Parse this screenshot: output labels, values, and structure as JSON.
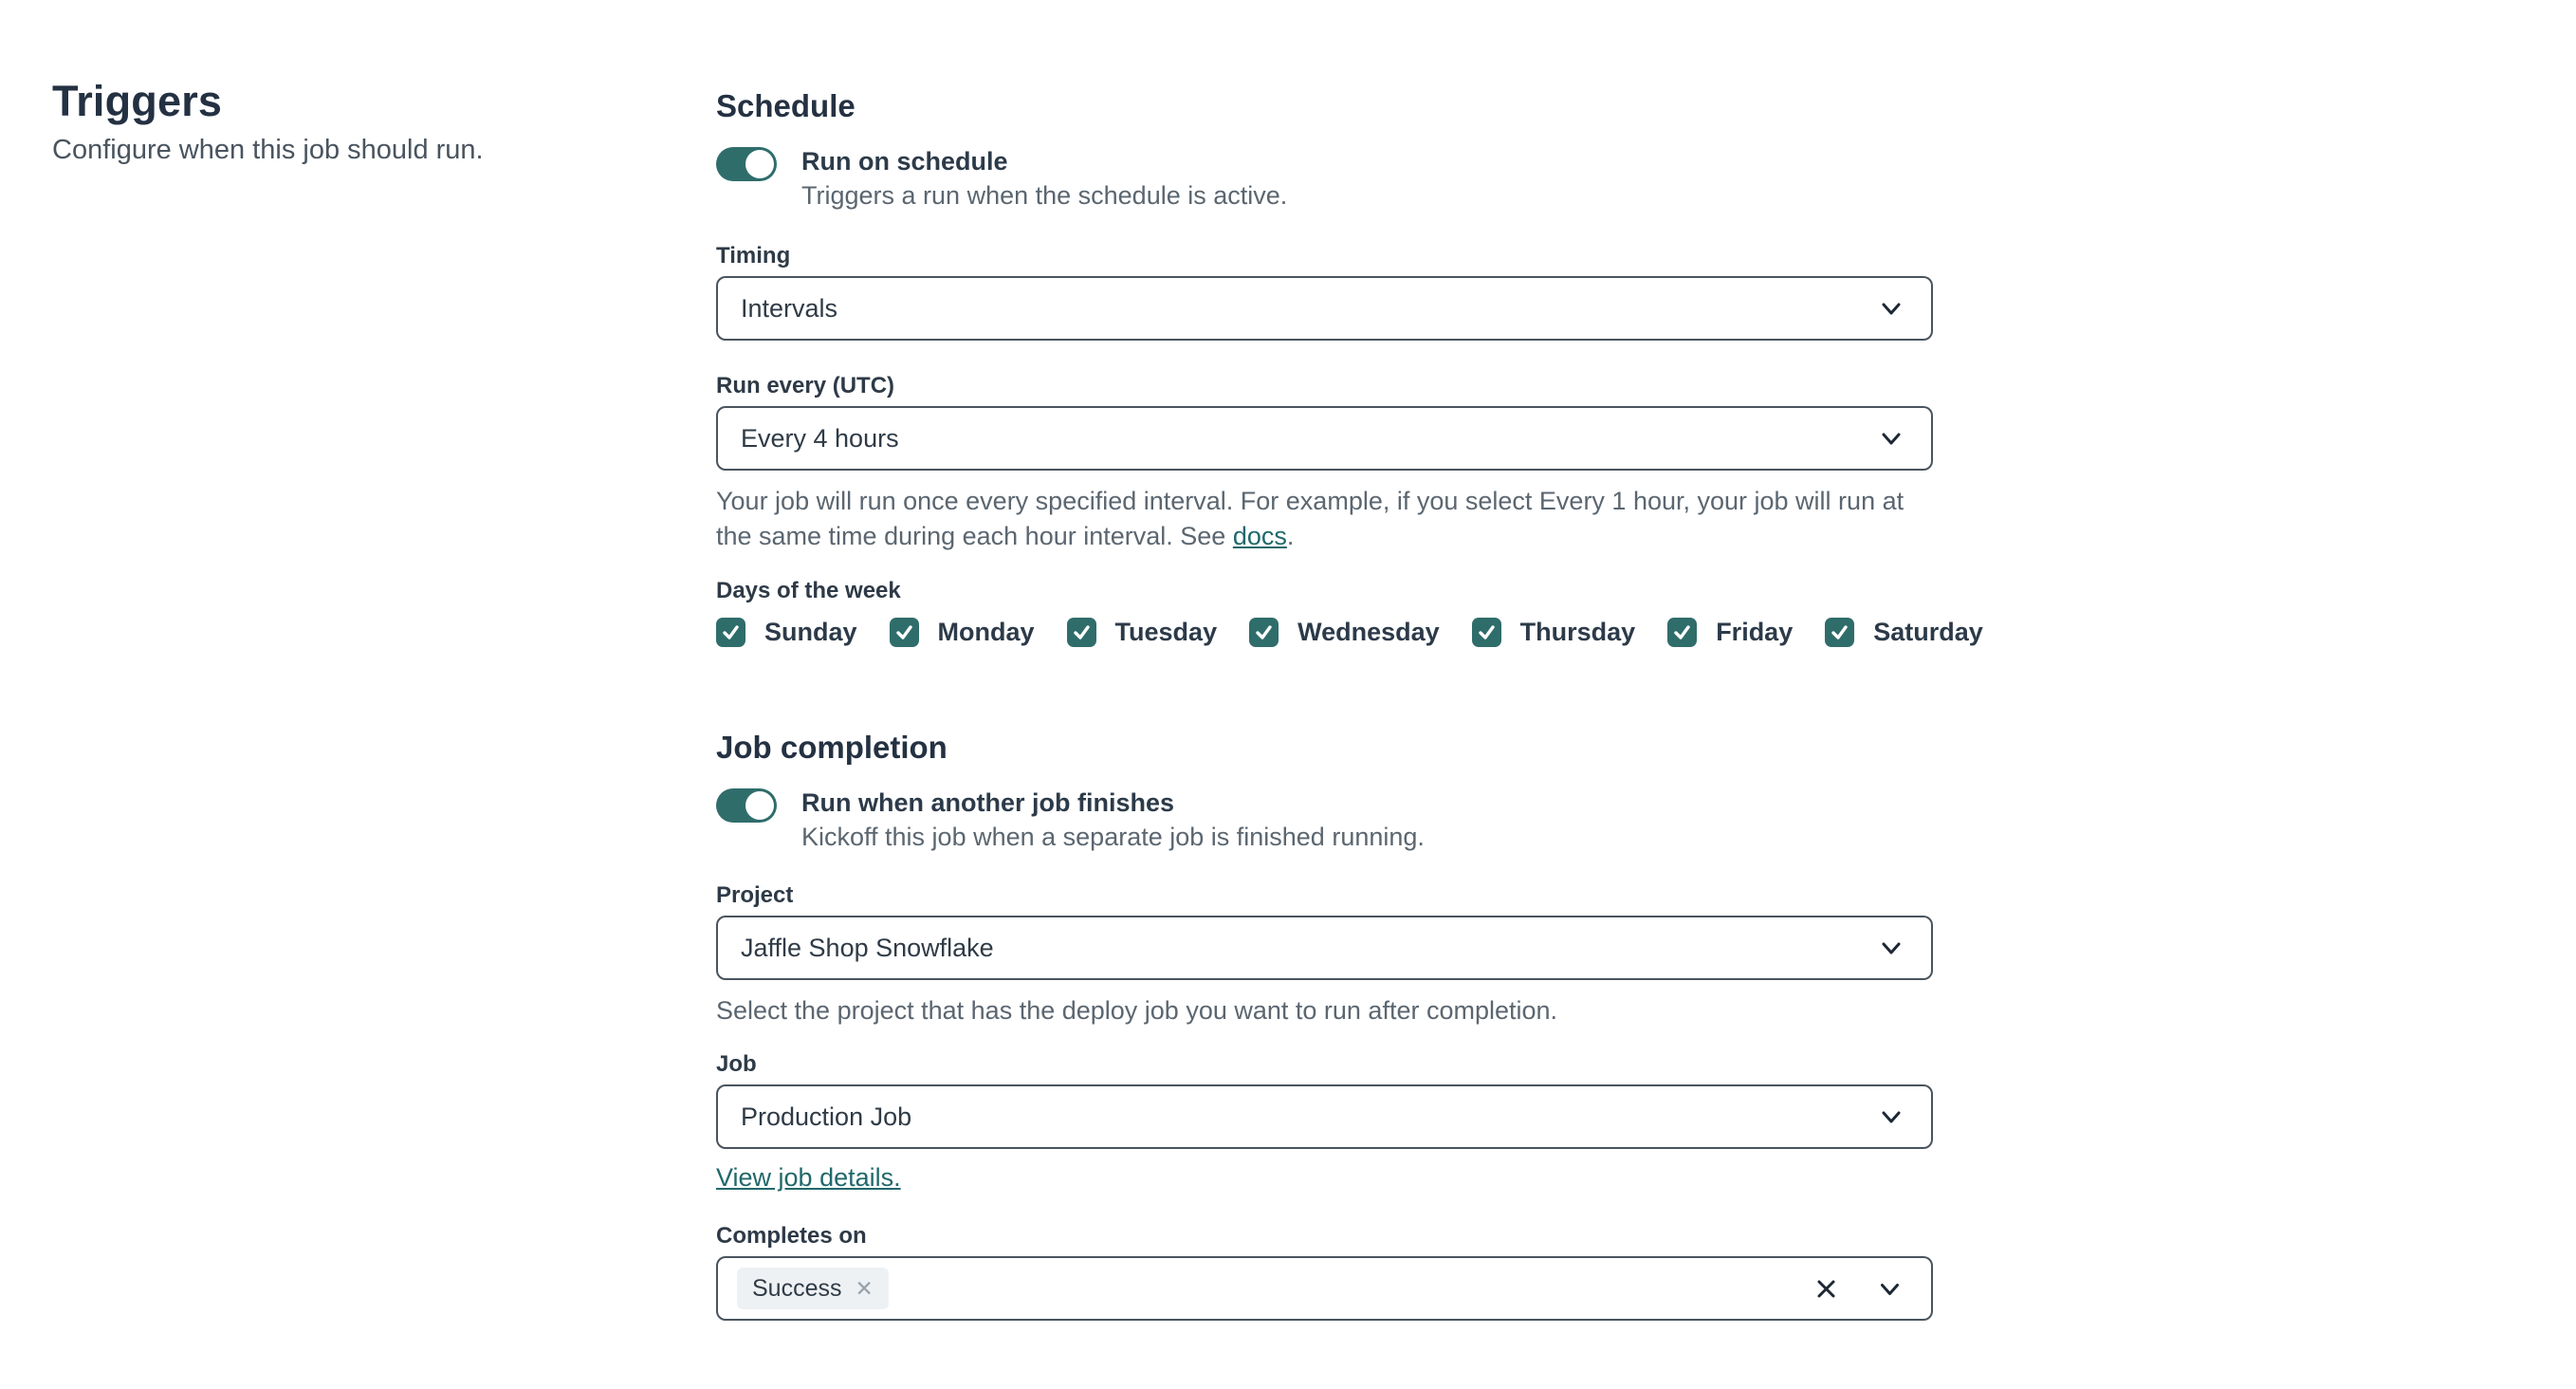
{
  "left": {
    "title": "Triggers",
    "subtitle": "Configure when this job should run."
  },
  "schedule": {
    "heading": "Schedule",
    "toggle": {
      "label": "Run on schedule",
      "description": "Triggers a run when the schedule is active.",
      "state": "on"
    },
    "timing": {
      "label": "Timing",
      "value": "Intervals"
    },
    "run_every": {
      "label": "Run every (UTC)",
      "value": "Every 4 hours",
      "help_before": "Your job will run once every specified interval. For example, if you select Every 1 hour, your job will run at the same time during each hour interval. See ",
      "help_link": "docs",
      "help_after": "."
    },
    "days": {
      "label": "Days of the week",
      "items": [
        {
          "label": "Sunday",
          "checked": true
        },
        {
          "label": "Monday",
          "checked": true
        },
        {
          "label": "Tuesday",
          "checked": true
        },
        {
          "label": "Wednesday",
          "checked": true
        },
        {
          "label": "Thursday",
          "checked": true
        },
        {
          "label": "Friday",
          "checked": true
        },
        {
          "label": "Saturday",
          "checked": true
        }
      ]
    }
  },
  "job_completion": {
    "heading": "Job completion",
    "toggle": {
      "label": "Run when another job finishes",
      "description": "Kickoff this job when a separate job is finished running.",
      "state": "on"
    },
    "project": {
      "label": "Project",
      "value": "Jaffle Shop Snowflake",
      "help": "Select the project that has the deploy job you want to run after completion."
    },
    "job": {
      "label": "Job",
      "value": "Production Job",
      "link": "View job details."
    },
    "completes_on": {
      "label": "Completes on",
      "tags": [
        "Success"
      ]
    }
  },
  "colors": {
    "accent_teal": "#2f6d6b",
    "link_teal": "#21686a",
    "heading_text": "#243142",
    "muted_text": "#5b6670",
    "field_border": "#49545e"
  }
}
